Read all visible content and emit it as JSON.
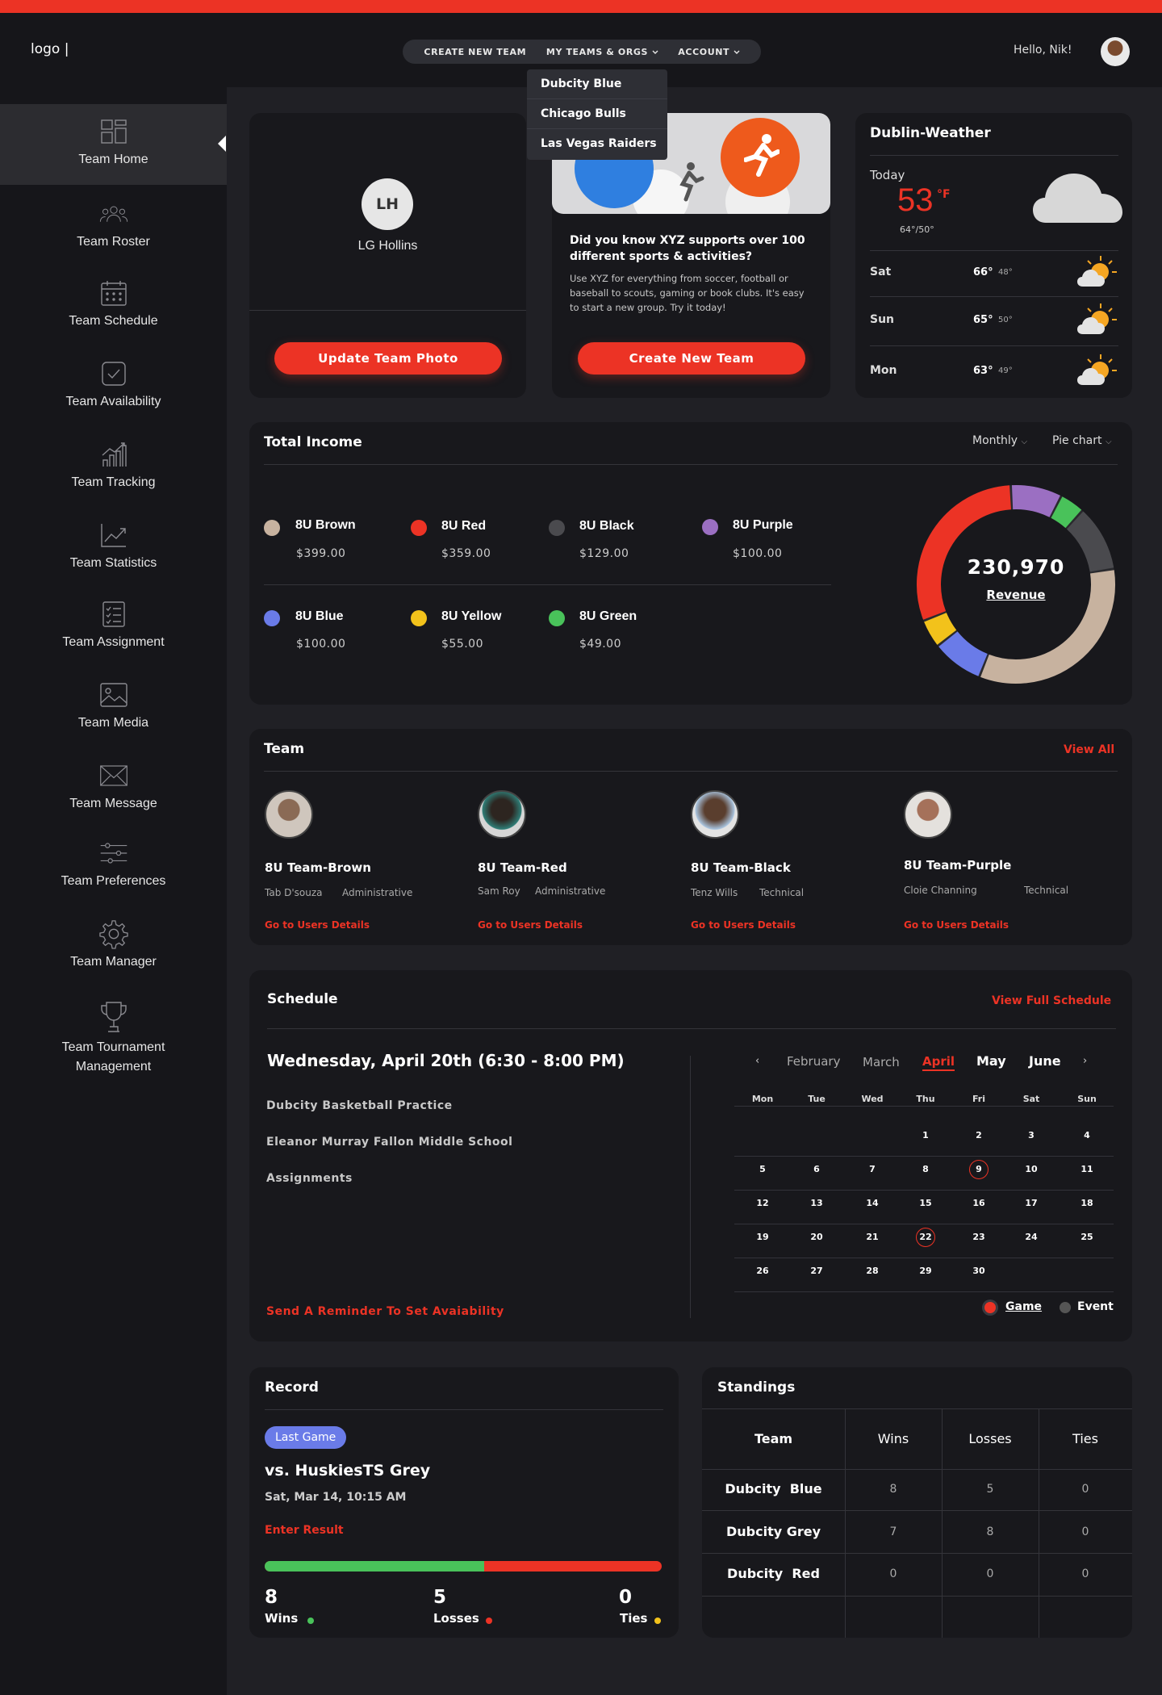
{
  "header": {
    "logo": "logo |",
    "nav": [
      "CREATE NEW TEAM",
      "MY TEAMS & ORGS",
      "ACCOUNT"
    ],
    "greeting": "Hello, Nik!"
  },
  "dropdown": [
    "Dubcity Blue",
    "Chicago Bulls",
    "Las Vegas Raiders"
  ],
  "sidebar": {
    "items": [
      {
        "label": "Team Home",
        "icon": "dashboard-icon"
      },
      {
        "label": "Team Roster",
        "icon": "users-icon"
      },
      {
        "label": "Team Schedule",
        "icon": "calendar-icon"
      },
      {
        "label": "Team Availability",
        "icon": "check-square-icon"
      },
      {
        "label": "Team Tracking",
        "icon": "bar-chart-icon"
      },
      {
        "label": "Team Statistics",
        "icon": "trend-chart-icon"
      },
      {
        "label": "Team Assignment",
        "icon": "checklist-icon"
      },
      {
        "label": "Team Media",
        "icon": "image-icon"
      },
      {
        "label": "Team Message",
        "icon": "envelope-icon"
      },
      {
        "label": "Team Preferences",
        "icon": "sliders-icon"
      },
      {
        "label": "Team Manager",
        "icon": "gear-icon"
      },
      {
        "label": "Team Tournament Management",
        "icon": "trophy-icon"
      }
    ]
  },
  "profile": {
    "initials": "LH",
    "name": "LG Hollins",
    "button": "Update Team Photo"
  },
  "promo": {
    "title": "Did you know XYZ supports over 100 different sports & activities?",
    "body": "Use XYZ for everything from soccer, football or baseball to scouts, gaming or book clubs. It's easy to start a new group. Try it today!",
    "button": "Create New Team"
  },
  "weather": {
    "title": "Dublin-Weather",
    "today_label": "Today",
    "temp": "53",
    "unit": "°F",
    "range": "64°/50°",
    "days": [
      {
        "day": "Sat",
        "high": "66°",
        "low": "48°"
      },
      {
        "day": "Sun",
        "high": "65°",
        "low": "50°"
      },
      {
        "day": "Mon",
        "high": "63°",
        "low": "49°"
      }
    ]
  },
  "income": {
    "title": "Total Income",
    "period": "Monthly",
    "view": "Pie chart",
    "total": "230,970",
    "total_label": "Revenue",
    "items": [
      {
        "name": "8U Brown",
        "amount": "$399.00",
        "color": "#c7b29f"
      },
      {
        "name": "8U Red",
        "amount": "$359.00",
        "color": "#ec3325"
      },
      {
        "name": "8U Black",
        "amount": "$129.00",
        "color": "#4a4a4e"
      },
      {
        "name": "8U Purple",
        "amount": "$100.00",
        "color": "#9b6fc2"
      },
      {
        "name": "8U Blue",
        "amount": "$100.00",
        "color": "#6a7be8"
      },
      {
        "name": "8U Yellow",
        "amount": "$55.00",
        "color": "#f2c21b"
      },
      {
        "name": "8U Green",
        "amount": "$49.00",
        "color": "#49c25a"
      }
    ]
  },
  "team": {
    "title": "Team",
    "view_all": "View All",
    "link": "Go to Users Details",
    "members": [
      {
        "team": "8U Team-Brown",
        "person": "Tab D'souza",
        "role": "Administrative"
      },
      {
        "team": "8U Team-Red",
        "person": "Sam Roy",
        "role": "Administrative"
      },
      {
        "team": "8U Team-Black",
        "person": "Tenz Wills",
        "role": "Technical"
      },
      {
        "team": "8U Team-Purple",
        "person": "Cloie Channing",
        "role": "Technical"
      }
    ]
  },
  "schedule": {
    "title": "Schedule",
    "view_full": "View Full Schedule",
    "event_date": "Wednesday, April 20th (6:30 - 8:00 PM)",
    "details": [
      "Dubcity Basketball Practice",
      "Eleanor Murray Fallon Middle School",
      "Assignments"
    ],
    "reminder": "Send A Reminder To Set Avaiability",
    "months": [
      "February",
      "March",
      "April",
      "May",
      "June"
    ],
    "weekdays": [
      "Mon",
      "Tue",
      "Wed",
      "Thu",
      "Fri",
      "Sat",
      "Sun"
    ],
    "legend": [
      "Game",
      "Event"
    ]
  },
  "record": {
    "title": "Record",
    "badge": "Last Game",
    "opponent": "vs. HuskiesTS Grey",
    "when": "Sat, Mar 14, 10:15 AM",
    "enter": "Enter Result",
    "wins": "8",
    "wins_label": "Wins",
    "losses": "5",
    "losses_label": "Losses",
    "ties": "0",
    "ties_label": "Ties",
    "win_fraction": 0.553
  },
  "standings": {
    "title": "Standings",
    "headers": [
      "Team",
      "Wins",
      "Losses",
      "Ties"
    ],
    "rows": [
      [
        "Dubcity  Blue",
        "8",
        "5",
        "0"
      ],
      [
        "Dubcity Grey",
        "7",
        "8",
        "0"
      ],
      [
        "Dubcity  Red",
        "0",
        "0",
        "0"
      ]
    ]
  }
}
